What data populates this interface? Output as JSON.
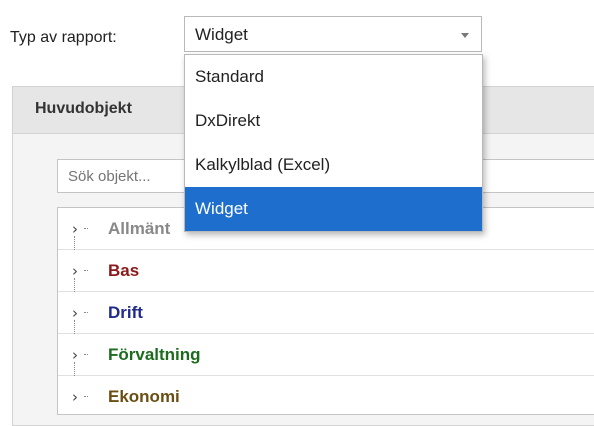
{
  "report_type": {
    "label": "Typ av rapport:",
    "selected": "Widget",
    "options": [
      "Standard",
      "DxDirekt",
      "Kalkylblad (Excel)",
      "Widget"
    ]
  },
  "panel": {
    "title": "Huvudobjekt",
    "search_placeholder": "Sök objekt...",
    "items": [
      {
        "label": "Allmänt",
        "color": "#888888"
      },
      {
        "label": "Bas",
        "color": "#8b1a1a"
      },
      {
        "label": "Drift",
        "color": "#1f2a8c"
      },
      {
        "label": "Förvaltning",
        "color": "#1d6b1d"
      },
      {
        "label": "Ekonomi",
        "color": "#6b4e12"
      }
    ]
  },
  "colors": {
    "selected_option_bg": "#1e6fcd"
  },
  "icons": {
    "tree_toggle": "chevron-right-icon",
    "select_arrow": "caret-down-icon"
  }
}
